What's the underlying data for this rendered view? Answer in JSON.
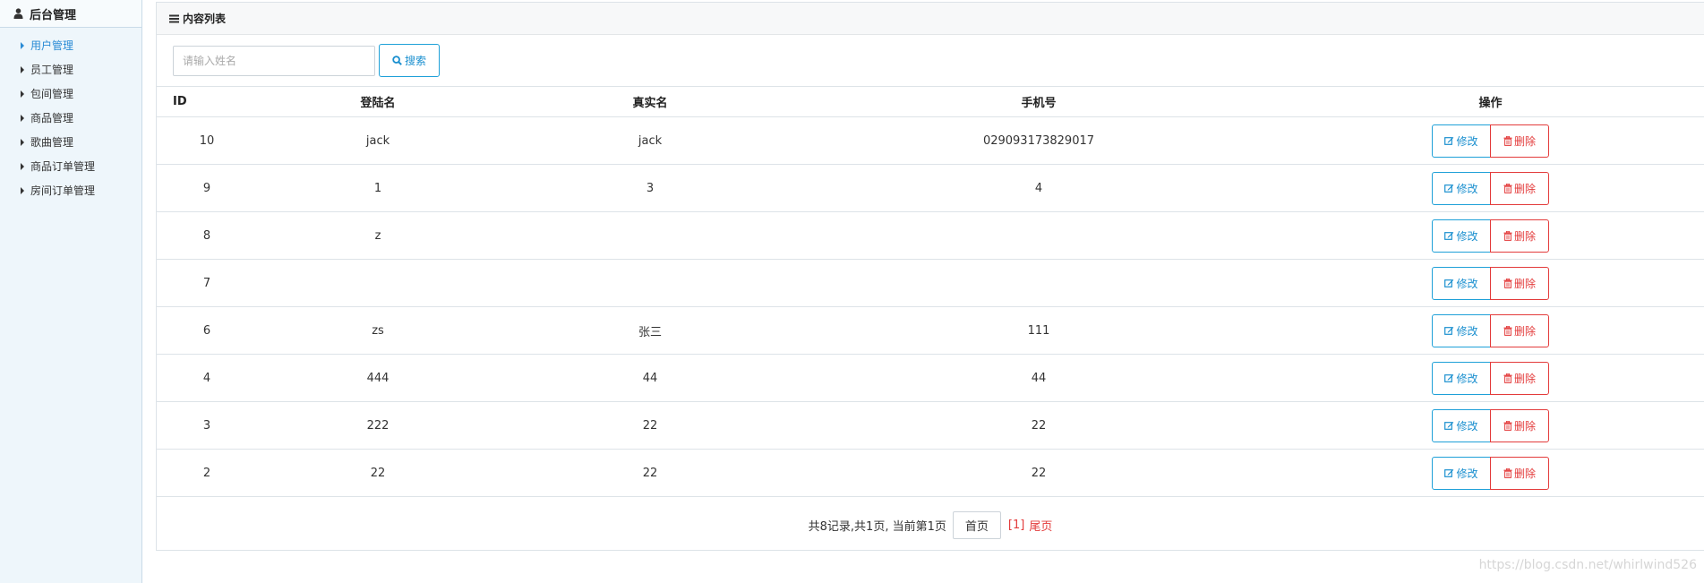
{
  "sidebar": {
    "title": "后台管理",
    "items": [
      {
        "label": "用户管理",
        "active": true
      },
      {
        "label": "员工管理"
      },
      {
        "label": "包间管理"
      },
      {
        "label": "商品管理"
      },
      {
        "label": "歌曲管理"
      },
      {
        "label": "商品订单管理"
      },
      {
        "label": "房间订单管理"
      }
    ]
  },
  "panel": {
    "title": "内容列表"
  },
  "search": {
    "placeholder": "请输入姓名",
    "value": "",
    "button_label": "搜索"
  },
  "table": {
    "headers": [
      "ID",
      "登陆名",
      "真实名",
      "手机号",
      "操作"
    ],
    "rows": [
      [
        "10",
        "jack",
        "jack",
        "029093173829017"
      ],
      [
        "9",
        "1",
        "3",
        "4"
      ],
      [
        "8",
        "z",
        "",
        ""
      ],
      [
        "7",
        "",
        "",
        ""
      ],
      [
        "6",
        "zs",
        "张三",
        "111"
      ],
      [
        "4",
        "444",
        "44",
        "44"
      ],
      [
        "3",
        "222",
        "22",
        "22"
      ],
      [
        "2",
        "22",
        "22",
        "22"
      ]
    ],
    "edit_label": "修改",
    "delete_label": "删除"
  },
  "pagination": {
    "summary": "共8记录,共1页, 当前第1页",
    "first_label": "首页",
    "current_label": "[1]",
    "last_label": "尾页"
  },
  "watermark": "https://blog.csdn.net/whirlwind526",
  "colors": {
    "accent": "#1a8fcf",
    "danger": "#e33b3b",
    "sidebar_bg": "#eef6fb"
  }
}
